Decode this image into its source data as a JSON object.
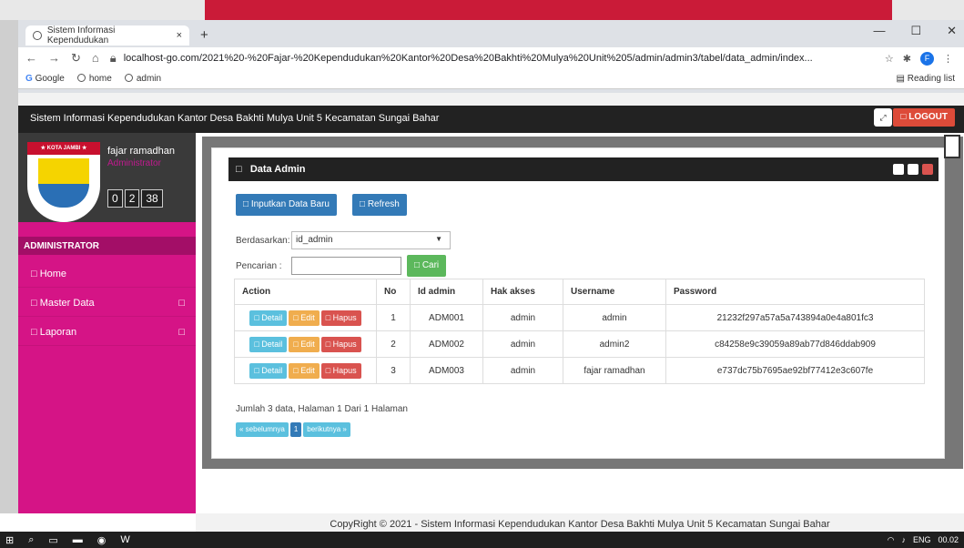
{
  "browser": {
    "tab_title": "Sistem Informasi Kependudukan",
    "url": "localhost-go.com/2021%20-%20Fajar-%20Kependudukan%20Kantor%20Desa%20Bakhti%20Mulya%20Unit%205/admin/admin3/tabel/data_admin/index...",
    "bookmarks": [
      "Google",
      "home",
      "admin"
    ],
    "reading_list": "Reading list",
    "avatar_letter": "F"
  },
  "app": {
    "title": "Sistem Informasi Kependudukan Kantor Desa Bakhti Mulya Unit 5 Kecamatan Sungai Bahar",
    "logout": "LOGOUT"
  },
  "user": {
    "name": "fajar ramadhan",
    "role": "Administrator",
    "logo_band": "★ KOTA JAMBI ★",
    "clock": [
      "0",
      "2",
      "38"
    ]
  },
  "sidebar": {
    "title": "ADMINISTRATOR",
    "items": [
      {
        "label": "□ Home",
        "caret": ""
      },
      {
        "label": "□ Master Data",
        "caret": "□"
      },
      {
        "label": "□ Laporan",
        "caret": "□"
      }
    ]
  },
  "panel": {
    "title": "Data Admin",
    "btn_new": "□ Inputkan Data Baru",
    "btn_refresh": "□ Refresh",
    "filter_label": "Berdasarkan:",
    "filter_value": "id_admin",
    "search_label": "Pencarian :",
    "btn_search": "□ Cari"
  },
  "table": {
    "headers": [
      "Action",
      "No",
      "Id admin",
      "Hak akses",
      "Username",
      "Password"
    ],
    "actions": {
      "detail": "□ Detail",
      "edit": "□ Edit",
      "hapus": "□ Hapus"
    },
    "rows": [
      {
        "no": "1",
        "id": "ADM001",
        "akses": "admin",
        "username": "admin",
        "password": "21232f297a57a5a743894a0e4a801fc3"
      },
      {
        "no": "2",
        "id": "ADM002",
        "akses": "admin",
        "username": "admin2",
        "password": "c84258e9c39059a89ab77d846ddab909"
      },
      {
        "no": "3",
        "id": "ADM003",
        "akses": "admin",
        "username": "fajar ramadhan",
        "password": "e737dc75b7695ae92bf77412e3c607fe"
      }
    ]
  },
  "info": "Jumlah 3 data, Halaman 1 Dari 1 Halaman",
  "pager": {
    "prev": "« sebelumnya",
    "page": "1",
    "next": "berikutnya »"
  },
  "footer": "CopyRight © 2021 - Sistem Informasi Kependudukan Kantor Desa Bakhti Mulya Unit 5 Kecamatan Sungai Bahar",
  "taskbar": {
    "lang": "ENG",
    "time": "00.02"
  },
  "colors": {
    "sidebar": "#d51486",
    "header": "#222222",
    "logout": "#dd4b39",
    "primary": "#337ab7"
  }
}
